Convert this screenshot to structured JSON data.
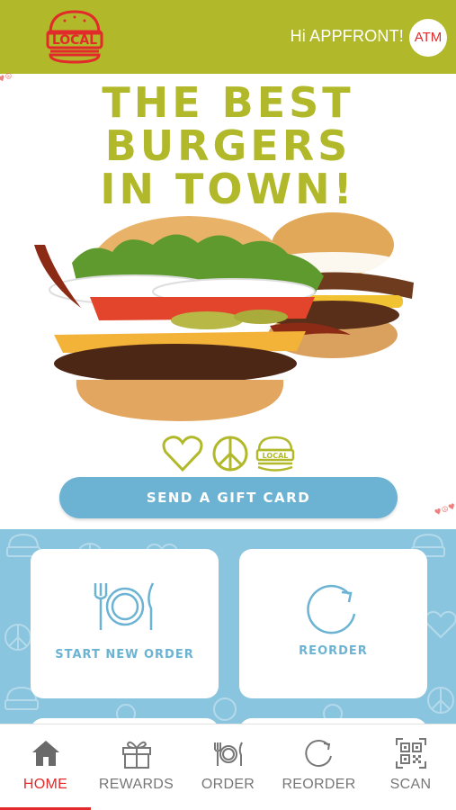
{
  "header": {
    "greeting": "Hi APPFRONT!",
    "avatar_initials": "ATM",
    "logo_text": "LOCAL",
    "background": "#b1b92a"
  },
  "hero": {
    "headline_lines": [
      "THE BEST",
      "BURGERS",
      "IN TOWN!"
    ],
    "badges": [
      "heart-icon",
      "peace-icon",
      "local-burger-icon"
    ],
    "badge_logo_text": "LOCAL",
    "gift_button": "SEND A GIFT CARD"
  },
  "actions": [
    {
      "label": "START NEW ORDER",
      "icon": "plate-cutlery-icon"
    },
    {
      "label": "REORDER",
      "icon": "reorder-circle-icon"
    }
  ],
  "tabs": [
    {
      "label": "HOME",
      "icon": "home-icon",
      "active": true
    },
    {
      "label": "REWARDS",
      "icon": "gift-icon",
      "active": false
    },
    {
      "label": "ORDER",
      "icon": "plate-cutlery-icon",
      "active": false
    },
    {
      "label": "REORDER",
      "icon": "reorder-icon",
      "active": false
    },
    {
      "label": "SCAN",
      "icon": "qr-code-icon",
      "active": false
    }
  ],
  "colors": {
    "brand_green": "#b1b92a",
    "accent_blue": "#6cb3d3",
    "panel_blue": "#8ac5df",
    "active_red": "#e22a2a"
  }
}
